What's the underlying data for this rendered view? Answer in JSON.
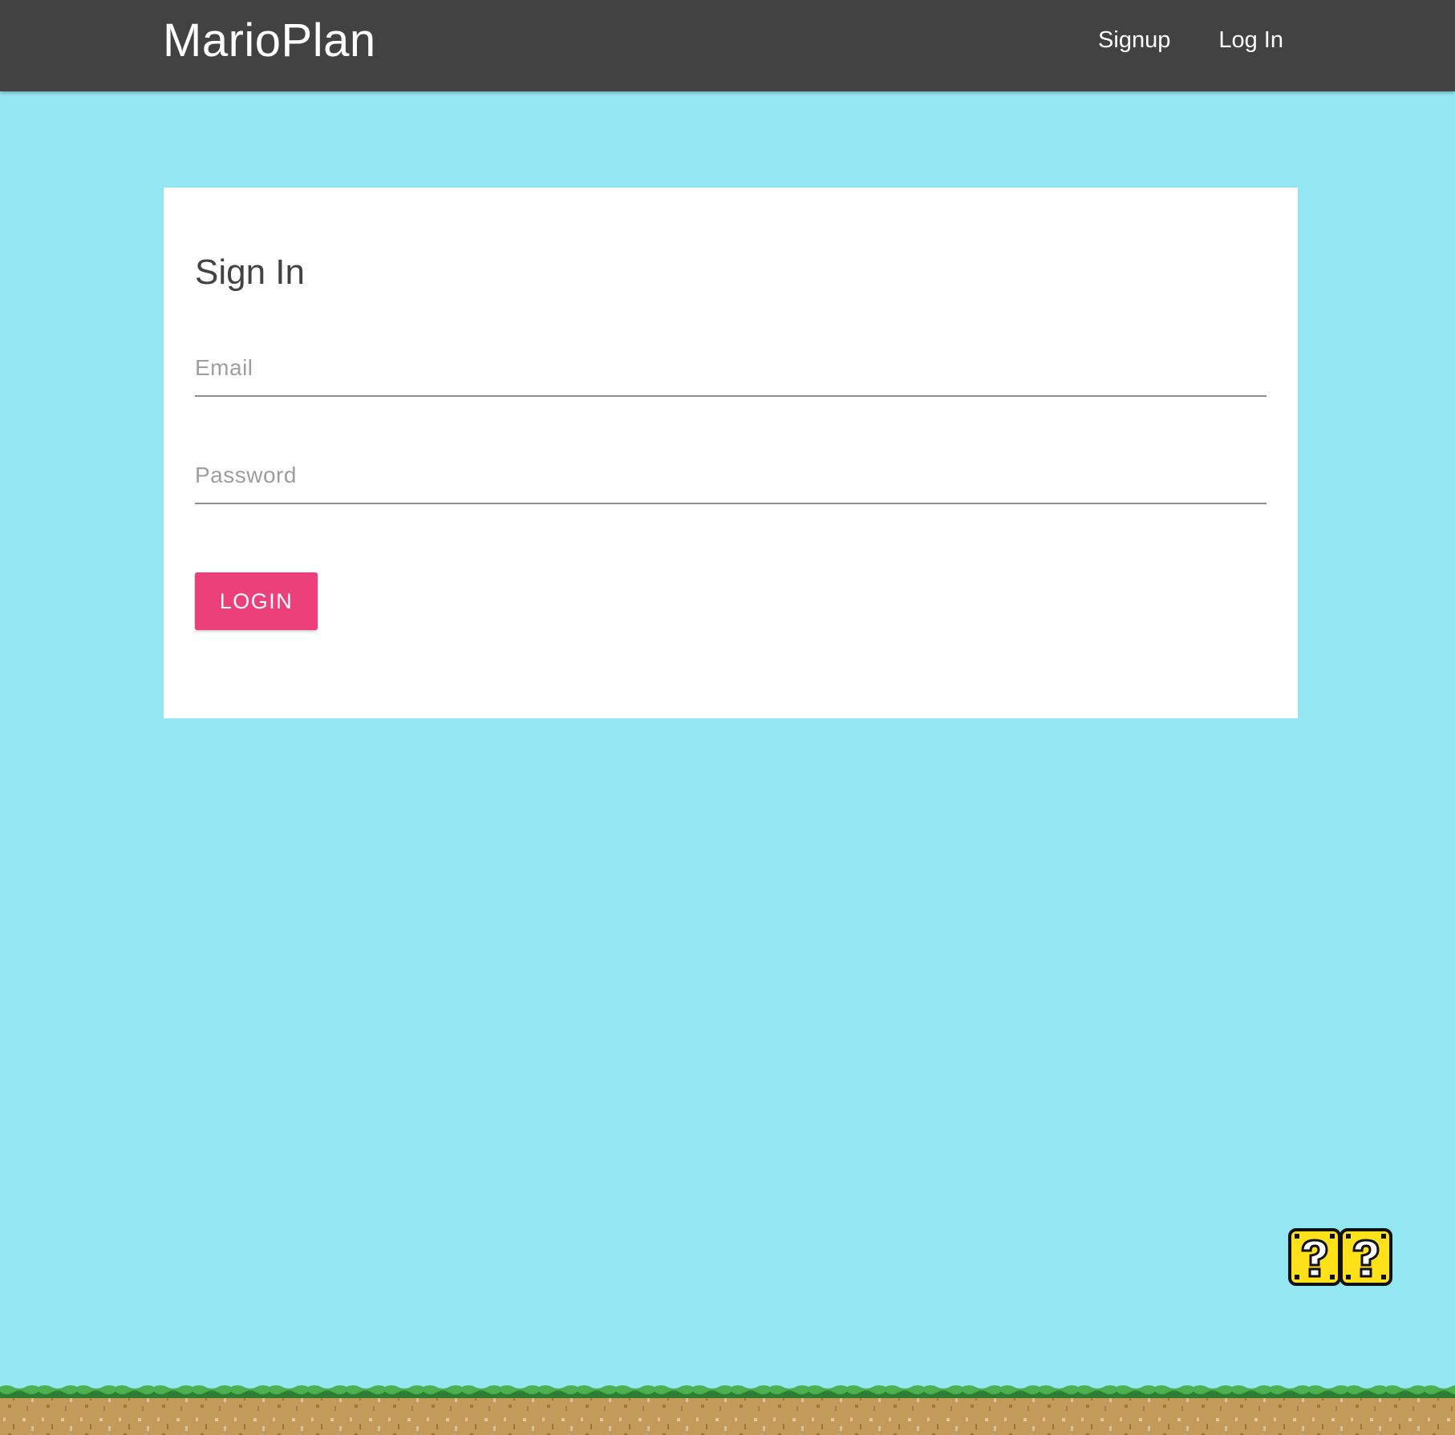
{
  "navbar": {
    "brand": "MarioPlan",
    "links": [
      {
        "label": "Signup"
      },
      {
        "label": "Log In"
      }
    ]
  },
  "signin": {
    "title": "Sign In",
    "email": {
      "placeholder": "Email",
      "value": ""
    },
    "password": {
      "placeholder": "Password",
      "value": ""
    },
    "login_label": "LOGIN"
  },
  "decorations": {
    "blocks": [
      "question-block-icon",
      "question-block-icon"
    ],
    "ground": "grass-ground"
  },
  "colors": {
    "navbar": "#424242",
    "background": "#95e6f3",
    "card": "#ffffff",
    "accent": "#ec407a",
    "block": "#ffe11a",
    "grass": "#4caf50",
    "dirt": "#c49a5b"
  }
}
